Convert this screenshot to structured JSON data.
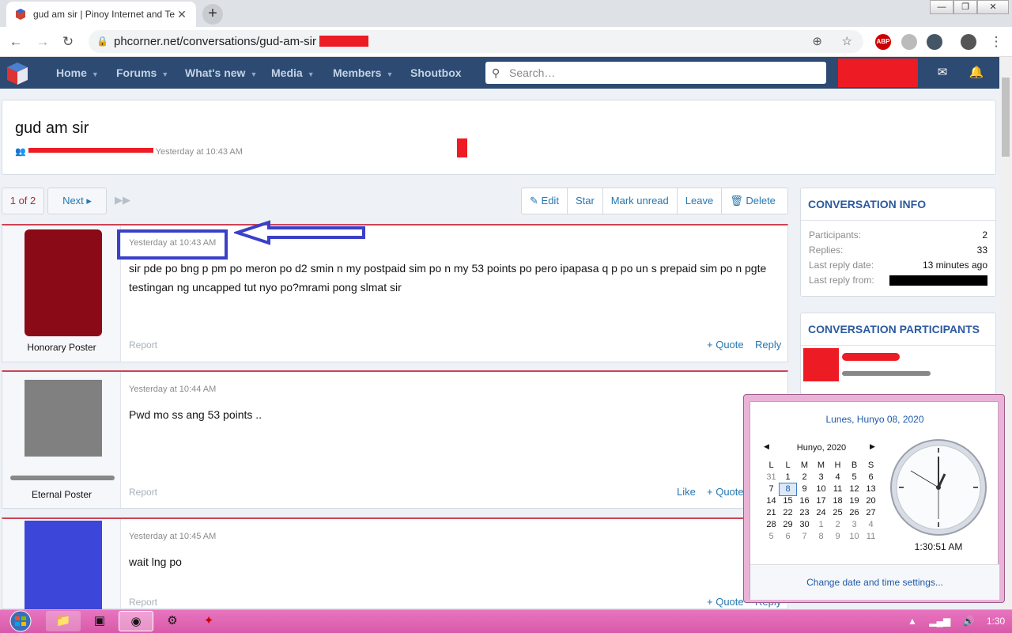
{
  "browser": {
    "tab_title": "gud am sir | Pinoy Internet and Te",
    "url": "phcorner.net/conversations/gud-am-sir",
    "new_tab": "+",
    "close": "✕"
  },
  "site_nav": {
    "items": [
      "Home",
      "Forums",
      "What's new",
      "Media",
      "Members",
      "Shoutbox"
    ],
    "search_placeholder": "Search…"
  },
  "conversation": {
    "title": "gud am sir",
    "meta_time": "Yesterday at 10:43 AM"
  },
  "pager": {
    "page": "1 of 2",
    "next": "Next"
  },
  "toolbar": {
    "edit": "Edit",
    "star": "Star",
    "mark_unread": "Mark unread",
    "leave": "Leave",
    "delete": "Delete"
  },
  "messages": [
    {
      "user_title": "Honorary Poster",
      "date": "Yesterday at 10:43 AM",
      "body": "sir pde po bng p pm po meron po d2 smin n my postpaid sim po n my 53 points po pero ipapasa q p po un s prepaid sim po n pgte testingan ng uncapped tut nyo po?mrami pong slmat sir",
      "report": "Report",
      "quote": "+ Quote",
      "reply": "Reply"
    },
    {
      "user_title": "Eternal Poster",
      "date": "Yesterday at 10:44 AM",
      "body": "Pwd mo ss ang 53 points ..",
      "report": "Report",
      "like": "Like",
      "quote": "+ Quote"
    },
    {
      "date": "Yesterday at 10:45 AM",
      "body": "wait lng po",
      "report": "Report",
      "quote": "+ Quote",
      "reply": "Reply"
    }
  ],
  "conversation_info": {
    "heading": "Conversation info",
    "participants_label": "Participants:",
    "participants_value": "2",
    "replies_label": "Replies:",
    "replies_value": "33",
    "last_reply_date_label": "Last reply date:",
    "last_reply_date_value": "13 minutes ago",
    "last_reply_from_label": "Last reply from:"
  },
  "participants_block": {
    "heading": "Conversation participants"
  },
  "calendar": {
    "full_date": "Lunes, Hunyo 08, 2020",
    "month": "Hunyo, 2020",
    "weekdays": [
      "L",
      "L",
      "M",
      "M",
      "H",
      "B",
      "S"
    ],
    "weeks": [
      [
        "31",
        "1",
        "2",
        "3",
        "4",
        "5",
        "6"
      ],
      [
        "7",
        "8",
        "9",
        "10",
        "11",
        "12",
        "13"
      ],
      [
        "14",
        "15",
        "16",
        "17",
        "18",
        "19",
        "20"
      ],
      [
        "21",
        "22",
        "23",
        "24",
        "25",
        "26",
        "27"
      ],
      [
        "28",
        "29",
        "30",
        "1",
        "2",
        "3",
        "4"
      ],
      [
        "5",
        "6",
        "7",
        "8",
        "9",
        "10",
        "11"
      ]
    ],
    "time": "1:30:51 AM",
    "change_link": "Change date and time settings..."
  },
  "taskbar": {
    "clock": "1:30 AM"
  },
  "colors": {
    "site_nav_bg": "#2c4a72",
    "link": "#2577b1",
    "annotation": "#3b40c8",
    "redaction": "#ed1c24",
    "taskbar": "#e070b8"
  }
}
